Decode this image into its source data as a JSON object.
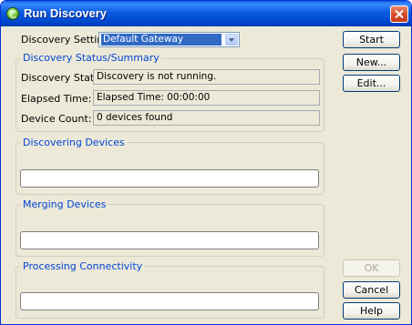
{
  "window": {
    "title": "Run Discovery",
    "app_icon": "discovery-globe-icon",
    "close_icon": "close-icon"
  },
  "settings": {
    "label": "Discovery Settings:",
    "selected": "Default Gateway",
    "dropdown_icon": "chevron-down-icon"
  },
  "status_group": {
    "title": "Discovery Status/Summary",
    "rows": [
      {
        "label": "Discovery Status:",
        "value": "Discovery is not running."
      },
      {
        "label": "Elapsed Time:",
        "value": "Elapsed Time: 00:00:00"
      },
      {
        "label": "Device Count:",
        "value": "0 devices found"
      }
    ]
  },
  "progress_groups": [
    {
      "title": "Discovering Devices",
      "progress": 0
    },
    {
      "title": "Merging Devices",
      "progress": 0
    },
    {
      "title": "Processing Connectivity",
      "progress": 0
    }
  ],
  "buttons": {
    "start": "Start",
    "new": "New...",
    "edit": "Edit...",
    "ok": "OK",
    "cancel": "Cancel",
    "help": "Help"
  },
  "colors": {
    "titlebar": "#0a5be0",
    "group_title": "#0046d5",
    "selection": "#316ac5",
    "dialog_bg": "#ece9d8"
  }
}
